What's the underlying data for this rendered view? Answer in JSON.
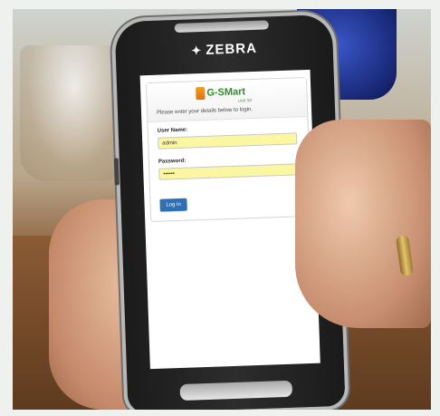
{
  "device": {
    "brand": "ZEBRA"
  },
  "app": {
    "name": "G-SMart",
    "subtitle": "LIVE SO"
  },
  "login": {
    "instructions": "Please enter your details below to login.",
    "username_label": "User Name:",
    "username_value": "admin",
    "password_label": "Password:",
    "password_value": "••••••",
    "login_button": "Log in"
  },
  "colors": {
    "input_bg": "#fbf6a2",
    "button_bg": "#2f6fb4",
    "logo_green": "#2f8a2f"
  }
}
